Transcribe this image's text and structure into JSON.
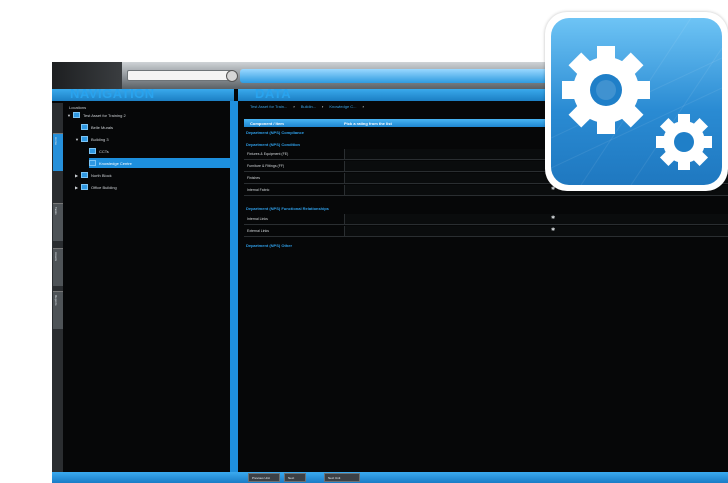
{
  "navigation": {
    "title": "NAVIGATION",
    "locations_label": "Locations",
    "tabs": [
      "Home",
      "Tasks",
      "Assets",
      "Reports"
    ],
    "tree": [
      {
        "label": "Test Asset for Training 2",
        "level": 0,
        "expanded": true
      },
      {
        "label": "Belle Murals",
        "level": 1
      },
      {
        "label": "Building 3",
        "level": 1,
        "expanded": true
      },
      {
        "label": "CCTs",
        "level": 2
      },
      {
        "label": "Knowledge Centre",
        "level": 2,
        "selected": true
      },
      {
        "label": "North Block",
        "level": 1
      },
      {
        "label": "Office Building",
        "level": 1
      }
    ]
  },
  "data_panel": {
    "title": "DATA",
    "breadcrumbs": [
      "Test Asset for Train...",
      "Buildin...",
      "Knowledge C..."
    ],
    "header": {
      "component": "Component / Item",
      "picklist": "Pick a rating from the list"
    },
    "sections": [
      {
        "title": "Department (NPS) Compliance",
        "rows": []
      },
      {
        "title": "Department (NPS) Condition",
        "rows": [
          "Fixtures & Equipment (FE)",
          "Furniture & Fittings (FF)",
          "Finishes",
          "Internal Fabric"
        ]
      },
      {
        "title": "Department (NPS) Functional Relationships",
        "rows": [
          "Internal Links",
          "External Links"
        ]
      },
      {
        "title": "Department (NPS) Other",
        "rows": []
      }
    ]
  },
  "bottom_bar": {
    "buttons": [
      "Previous Unit",
      "Next",
      "Next Unit"
    ]
  },
  "badge": {
    "icon": "gear-icon"
  },
  "colors": {
    "accent": "#1f8fdd",
    "panel": "#060708",
    "toolbar": "#8d9398"
  }
}
